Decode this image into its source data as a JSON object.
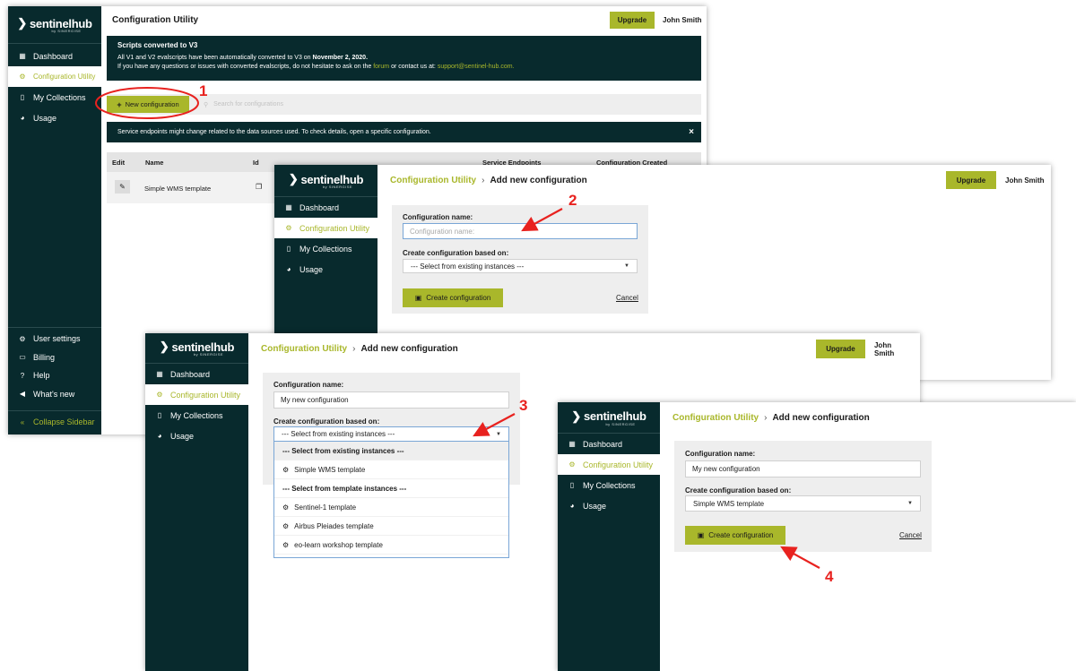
{
  "brand": {
    "name": "sentinelhub",
    "sub": "by SINERGISE",
    "accent": "#a9b72b",
    "sidebar_bg": "#082a2d"
  },
  "nav": {
    "dashboard": "Dashboard",
    "config": "Configuration Utility",
    "collections": "My Collections",
    "usage": "Usage"
  },
  "nav_bottom": {
    "settings": "User settings",
    "billing": "Billing",
    "help": "Help",
    "whatsnew": "What's new",
    "collapse": "Collapse Sidebar"
  },
  "icons": {
    "dashboard": "grid-icon",
    "config": "config-icon",
    "collections": "map-icon",
    "usage": "pie-chart-icon",
    "settings": "gears-icon",
    "billing": "card-icon",
    "help": "question-icon",
    "whatsnew": "megaphone-icon",
    "collapse": "double-chevron-left-icon"
  },
  "topbar": {
    "upgrade": "Upgrade",
    "user": "John Smith"
  },
  "panel1": {
    "title": "Configuration Utility",
    "notice_title": "Scripts converted to V3",
    "notice_line1_pre": "All V1 and V2 evalscripts have been automatically converted to V3 on ",
    "notice_line1_date": "November 2, 2020.",
    "notice_line2_pre": "If you have any questions or issues with converted evalscripts, do not hesitate to ask on the ",
    "notice_forum": "forum",
    "notice_mid": " or contact us at: ",
    "notice_email": "support@sentinel-hub.com.",
    "new_config": "New configuration",
    "search_placeholder": "Search for configurations",
    "info": "Service endpoints might change related to the data sources used. To check details, open a specific configuration.",
    "close": "×",
    "table_headers": {
      "edit": "Edit",
      "name": "Name",
      "id": "Id",
      "endpoints": "Service Endpoints",
      "created": "Configuration Created"
    },
    "row_name": "Simple WMS template"
  },
  "breadcrumb": {
    "parent": "Configuration Utility",
    "sep": "›",
    "current": "Add new configuration"
  },
  "form": {
    "name_label": "Configuration name:",
    "name_placeholder": "Configuration name:",
    "name_value": "My new configuration",
    "based_label": "Create configuration based on:",
    "based_default": "--- Select from existing instances ---",
    "based_selected": "Simple WMS template",
    "create": "Create configuration",
    "cancel": "Cancel"
  },
  "dropdown": {
    "group1": "--- Select from existing instances ---",
    "item1": "Simple WMS template",
    "group2": "--- Select from template instances ---",
    "item2": "Sentinel-1 template",
    "item3": "Airbus Pleiades template",
    "item4": "eo-learn workshop template"
  },
  "steps": {
    "s1": "1",
    "s2": "2",
    "s3": "3",
    "s4": "4"
  },
  "annotation_color": "#e8221f"
}
